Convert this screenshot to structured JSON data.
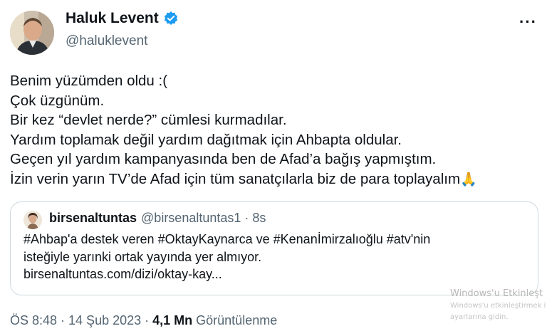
{
  "tweet": {
    "author_name": "Haluk Levent",
    "author_handle": "@haluklevent",
    "more_label": "···",
    "lines": [
      "Benim yüzümden oldu :(",
      "Çok üzgünüm.",
      "Bir kez “devlet nerde?” cümlesi kurmadılar.",
      "Yardım toplamak değil yardım dağıtmak için Ahbapta oldular.",
      "Geçen yıl yardım kampanyasında ben de Afad’a bağış yapmıştım.",
      "İzin verin yarın TV’de Afad için tüm sanatçılarla biz de para toplayalım"
    ],
    "emoji": "🙏"
  },
  "quote": {
    "author_name": "birsenaltuntas",
    "meta": "@birsenaltuntas1 · 8s",
    "lines": [
      "#Ahbap'a destek veren #OktayKaynarca ve #Kenanİmirzalıoğlu #atv'nin",
      "isteğiyle yarınki ortak yayında yer almıyor.",
      "birsenaltuntas.com/dizi/oktay-kay..."
    ]
  },
  "footer": {
    "time": "ÖS 8:48 · 14 Şub 2023 · ",
    "views": "4,1 Mn",
    "views_label": " Görüntülenme"
  },
  "watermark": {
    "line1": "Windows'u Etkinleşt",
    "line2": "Windows'u etkinleştirmek i",
    "line3": "ayarlarına gidin."
  },
  "colors": {
    "verified": "#1d9bf0",
    "secondary_text": "#536471",
    "border": "#cfd9de"
  },
  "icons": {
    "verified": "verified-badge-icon",
    "more": "more-dots-icon"
  }
}
